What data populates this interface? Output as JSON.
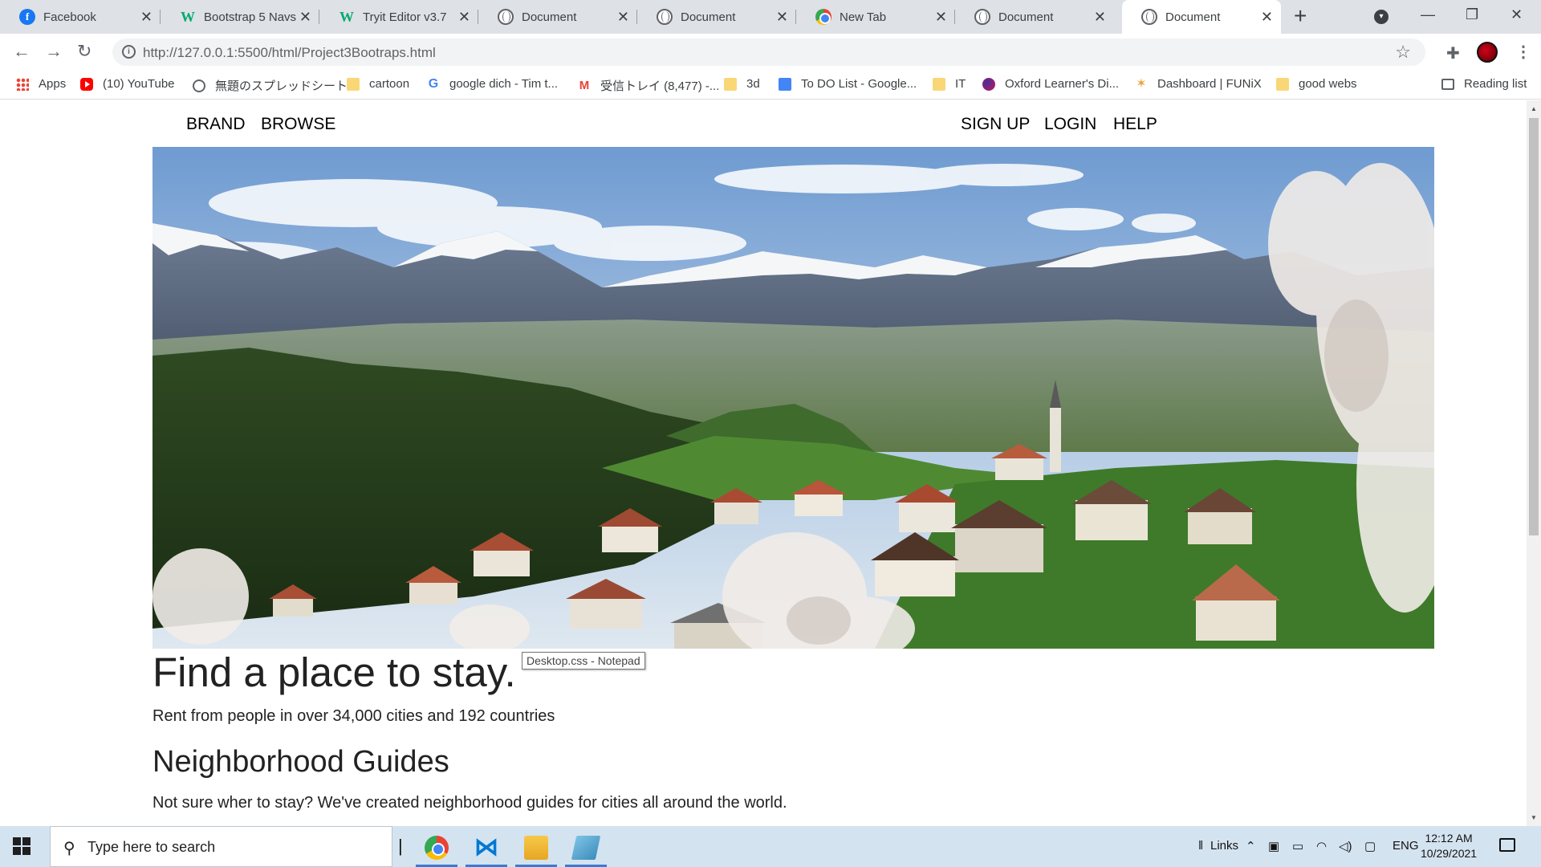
{
  "browser": {
    "tabs": [
      {
        "title": "Facebook",
        "icon": "facebook-icon",
        "active": false
      },
      {
        "title": "Bootstrap 5 Navs",
        "icon": "w3schools-icon",
        "active": false
      },
      {
        "title": "Tryit Editor v3.7",
        "icon": "w3schools-icon",
        "active": false
      },
      {
        "title": "Document",
        "icon": "globe-icon",
        "active": false
      },
      {
        "title": "Document",
        "icon": "globe-icon",
        "active": false
      },
      {
        "title": "New Tab",
        "icon": "chrome-icon",
        "active": false
      },
      {
        "title": "Document",
        "icon": "globe-icon",
        "active": false
      },
      {
        "title": "Document",
        "icon": "globe-icon",
        "active": true
      }
    ],
    "url": "http://127.0.0.1:5500/html/Project3Bootraps.html",
    "bookmarks": [
      {
        "label": "Apps",
        "icon": "apps-grid-icon"
      },
      {
        "label": "(10) YouTube",
        "icon": "youtube-icon"
      },
      {
        "label": "無題のスプレッドシート...",
        "icon": "globe-icon"
      },
      {
        "label": "cartoon",
        "icon": "folder-icon"
      },
      {
        "label": "google dich - Tim t...",
        "icon": "google-icon"
      },
      {
        "label": "受信トレイ (8,477) -...",
        "icon": "gmail-icon"
      },
      {
        "label": "3d",
        "icon": "folder-icon"
      },
      {
        "label": "To DO List - Google...",
        "icon": "google-docs-icon"
      },
      {
        "label": "IT",
        "icon": "folder-icon"
      },
      {
        "label": "Oxford Learner's Di...",
        "icon": "oxford-icon"
      },
      {
        "label": "Dashboard | FUNiX",
        "icon": "funix-icon"
      },
      {
        "label": "good webs",
        "icon": "folder-icon"
      }
    ],
    "reading_list": "Reading list"
  },
  "site": {
    "nav_left": [
      "BRAND",
      "BROWSE"
    ],
    "nav_right": [
      "SIGN UP",
      "LOGIN",
      "HELP"
    ],
    "hero_image": "alpine-village-landscape",
    "heading": "Find a place to stay.",
    "lead": "Rent from people in over 34,000 cities and 192 countries",
    "section_heading": "Neighborhood Guides",
    "section_text": "Not sure wher to stay? We've created neighborhood guides for cities all around the world."
  },
  "tooltip": "Desktop.css - Notepad",
  "taskbar": {
    "search_placeholder": "Type here to search",
    "apps": [
      "chrome-icon",
      "vscode-icon",
      "file-explorer-icon",
      "notepad-icon"
    ],
    "links_label": "Links",
    "language": "ENG",
    "time": "12:12 AM",
    "date": "10/29/2021"
  }
}
